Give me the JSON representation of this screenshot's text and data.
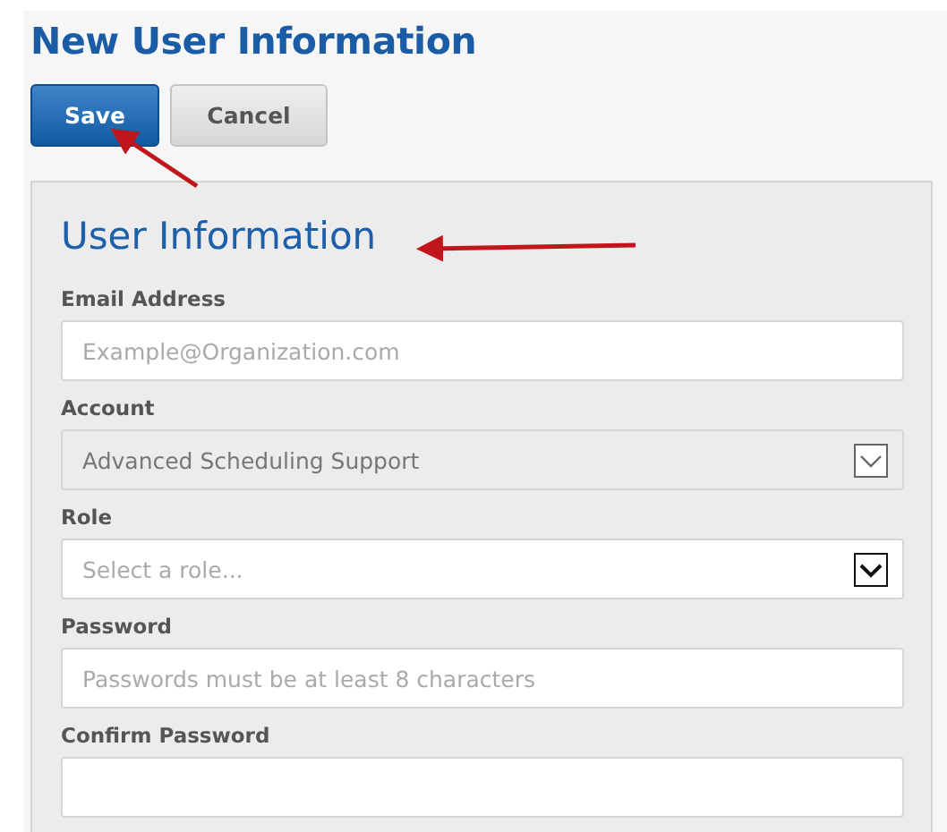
{
  "page_title": "New User Information",
  "buttons": [
    {
      "label": "Save",
      "kind": "primary"
    },
    {
      "label": "Cancel",
      "kind": "secondary"
    }
  ],
  "panel": {
    "heading": "User Information",
    "fields": [
      {
        "label": "Email Address",
        "kind": "text",
        "placeholder": "Example@Organization.com"
      },
      {
        "label": "Account",
        "kind": "select",
        "value": "Advanced Scheduling Support",
        "disabled": true
      },
      {
        "label": "Role",
        "kind": "select",
        "placeholder": "Select a role...",
        "disabled": false
      },
      {
        "label": "Password",
        "kind": "text",
        "placeholder": "Passwords must be at least 8 characters"
      },
      {
        "label": "Confirm Password",
        "kind": "text"
      }
    ]
  }
}
